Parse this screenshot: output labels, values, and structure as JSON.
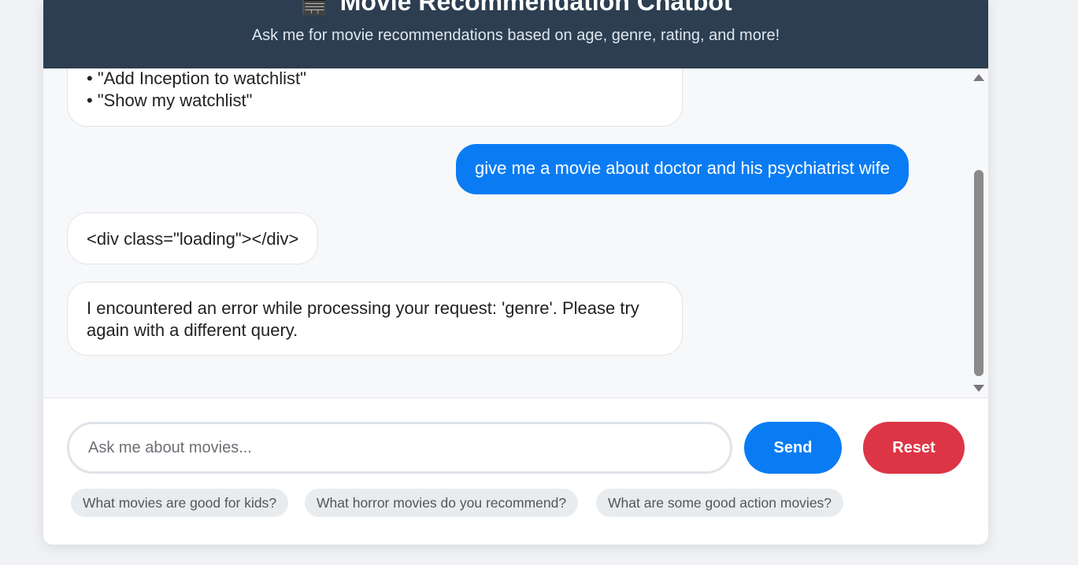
{
  "header": {
    "icon": "clapper-board-emoji",
    "emoji": "🎬",
    "title": "Movie Recommendation Chatbot",
    "subtitle": "Ask me for movie recommendations based on age, genre, rating, and more!"
  },
  "messages": [
    {
      "role": "bot",
      "lines": [
        "• \"Add Inception to watchlist\"",
        "• \"Show my watchlist\""
      ]
    },
    {
      "role": "user",
      "text": "give me a movie about doctor and his psychiatrist wife"
    },
    {
      "role": "bot",
      "text": "<div class=\"loading\"></div>"
    },
    {
      "role": "bot",
      "text": "I encountered an error while processing your request: 'genre'. Please try again with a different query."
    }
  ],
  "input": {
    "placeholder": "Ask me about movies...",
    "value": ""
  },
  "buttons": {
    "send_label": "Send",
    "reset_label": "Reset"
  },
  "suggestions": [
    "What movies are good for kids?",
    "What horror movies do you recommend?",
    "What are some good action movies?"
  ],
  "colors": {
    "header_bg": "#2c3e50",
    "user_bubble": "#0a7cf3",
    "send_button": "#0a7cf3",
    "reset_button": "#dc3545"
  }
}
